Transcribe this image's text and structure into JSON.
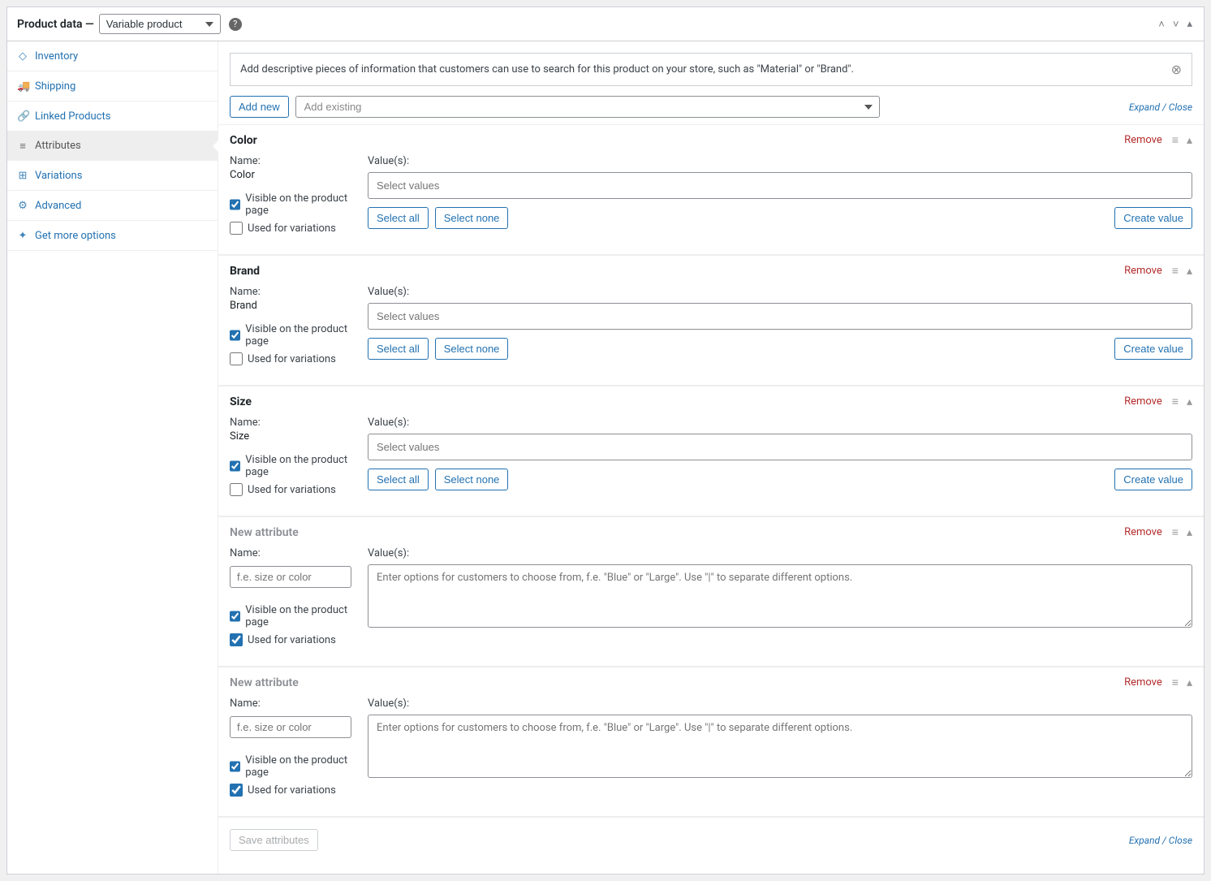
{
  "header": {
    "title": "Product data —",
    "product_type": "Variable product",
    "help_char": "?"
  },
  "sidebar": {
    "items": [
      {
        "icon": "◇",
        "label": "Inventory"
      },
      {
        "icon": "🚚",
        "label": "Shipping"
      },
      {
        "icon": "🔗",
        "label": "Linked Products"
      },
      {
        "icon": "≡",
        "label": "Attributes"
      },
      {
        "icon": "⊞",
        "label": "Variations"
      },
      {
        "icon": "⚙",
        "label": "Advanced"
      },
      {
        "icon": "✦",
        "label": "Get more options"
      }
    ]
  },
  "notice": {
    "text": "Add descriptive pieces of information that customers can use to search for this product on your store, such as \"Material\" or \"Brand\"."
  },
  "toolbar": {
    "add_new": "Add new",
    "add_existing_placeholder": "Add existing",
    "expand_close": "Expand / Close"
  },
  "labels": {
    "name": "Name:",
    "values": "Value(s):",
    "visible": "Visible on the product page",
    "used_variations": "Used for variations",
    "select_all": "Select all",
    "select_none": "Select none",
    "create_value": "Create value",
    "remove": "Remove",
    "values_placeholder": "Select values",
    "name_placeholder": "f.e. size or color",
    "textarea_placeholder": "Enter options for customers to choose from, f.e. \"Blue\" or \"Large\". Use \"|\" to separate different options.",
    "save_attributes": "Save attributes"
  },
  "attributes": [
    {
      "title": "Color",
      "new": false,
      "name_value": "Color",
      "visible": true,
      "used": false
    },
    {
      "title": "Brand",
      "new": false,
      "name_value": "Brand",
      "visible": true,
      "used": false
    },
    {
      "title": "Size",
      "new": false,
      "name_value": "Size",
      "visible": true,
      "used": false
    },
    {
      "title": "New attribute",
      "new": true,
      "name_value": "",
      "visible": true,
      "used": true
    },
    {
      "title": "New attribute",
      "new": true,
      "name_value": "",
      "visible": true,
      "used": true
    }
  ]
}
